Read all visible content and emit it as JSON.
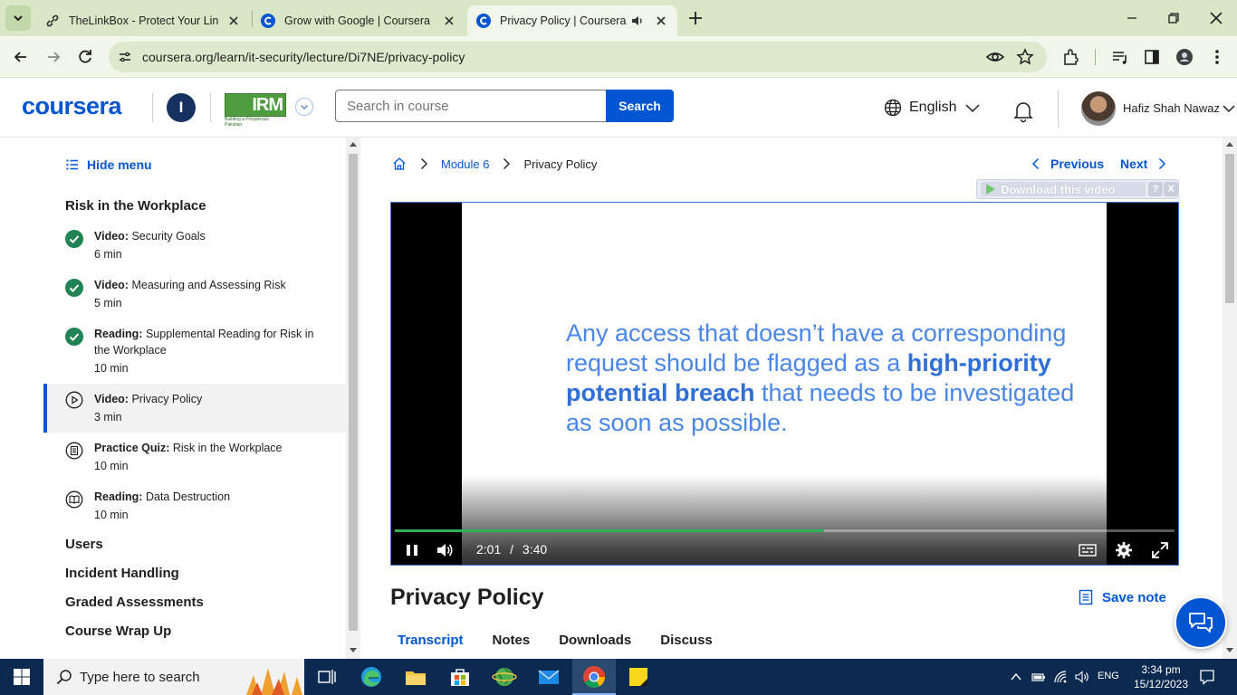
{
  "browser": {
    "tabs": [
      {
        "title": "TheLinkBox - Protect Your Link A",
        "icon": "link-favicon"
      },
      {
        "title": "Grow with Google | Coursera",
        "icon": "coursera-favicon"
      },
      {
        "title": "Privacy Policy | Coursera",
        "icon": "coursera-favicon",
        "active": true,
        "audio": true
      }
    ],
    "url": "coursera.org/learn/it-security/lecture/Di7NE/privacy-policy"
  },
  "header": {
    "logo": "coursera",
    "institution_initial": "I",
    "partner_logo": "IRM",
    "partner_tagline": "Building a Prosperous Pakistan",
    "search_placeholder": "Search in course",
    "search_button": "Search",
    "language": "English",
    "username": "Hafiz Shah Nawaz"
  },
  "sidebar": {
    "hide_menu": "Hide menu",
    "section": "Risk in the Workplace",
    "items": [
      {
        "type": "Video:",
        "title": "Security Goals",
        "duration": "6 min",
        "status": "completed"
      },
      {
        "type": "Video:",
        "title": "Measuring and Assessing Risk",
        "duration": "5 min",
        "status": "completed"
      },
      {
        "type": "Reading:",
        "title": "Supplemental Reading for Risk in the Workplace",
        "duration": "10 min",
        "status": "completed"
      },
      {
        "type": "Video:",
        "title": "Privacy Policy",
        "duration": "3 min",
        "status": "current"
      },
      {
        "type": "Practice Quiz:",
        "title": "Risk in the Workplace",
        "duration": "10 min",
        "status": "quiz"
      },
      {
        "type": "Reading:",
        "title": "Data Destruction",
        "duration": "10 min",
        "status": "reading"
      }
    ],
    "modules": [
      "Users",
      "Incident Handling",
      "Graded Assessments",
      "Course Wrap Up"
    ]
  },
  "breadcrumb": {
    "module": "Module 6",
    "current": "Privacy Policy"
  },
  "nav": {
    "previous": "Previous",
    "next": "Next"
  },
  "download": {
    "label": "Download this video",
    "help": "?",
    "close": "X"
  },
  "video": {
    "slide_line1": "Any access that doesn’t have a corresponding",
    "slide_line2a": "request should be flagged as a ",
    "slide_line2b": "high-priority",
    "slide_line3a": "potential breach",
    "slide_line3b": " that needs to be investigated",
    "slide_line4": "as soon as possible.",
    "current_time": "2:01",
    "time_sep": "/",
    "duration": "3:40",
    "progress_fraction": 0.55,
    "progress_color": "#2fb158"
  },
  "lecture": {
    "title": "Privacy Policy",
    "save_note": "Save note",
    "tabs": [
      "Transcript",
      "Notes",
      "Downloads",
      "Discuss"
    ],
    "active_tab": "Transcript"
  },
  "taskbar": {
    "search_placeholder": "Type here to search",
    "language": "ENG",
    "time": "3:34 pm",
    "date": "15/12/2023"
  },
  "colors": {
    "accent": "#0056d2",
    "chrome_tabbar": "#d9e7c6",
    "completed": "#1f8354",
    "taskbar": "#0c2a4f"
  }
}
